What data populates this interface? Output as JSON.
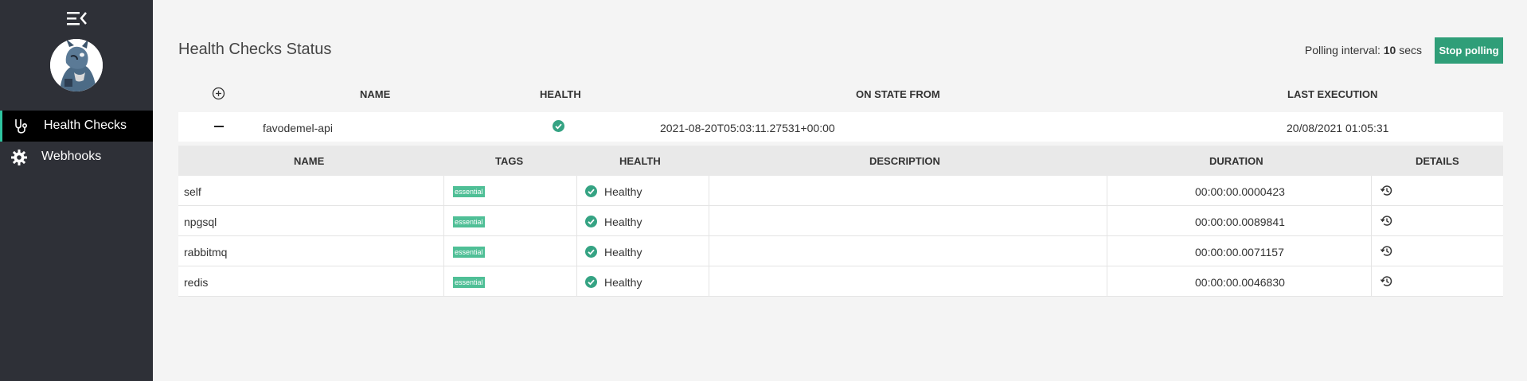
{
  "sidebar": {
    "items": [
      {
        "label": "Health Checks",
        "icon": "stethoscope-icon",
        "active": true
      },
      {
        "label": "Webhooks",
        "icon": "gear-icon",
        "active": false
      }
    ]
  },
  "header": {
    "title": "Health Checks Status",
    "polling_prefix": "Polling interval: ",
    "polling_value": "10",
    "polling_suffix": " secs",
    "stop_label": "Stop polling"
  },
  "outer_table": {
    "columns": [
      "NAME",
      "HEALTH",
      "ON STATE FROM",
      "LAST EXECUTION"
    ],
    "service": {
      "name": "favodemel-api",
      "on_state_from": "2021-08-20T05:03:11.27531+00:00",
      "last_execution": "20/08/2021 01:05:31"
    }
  },
  "inner_table": {
    "columns": [
      "NAME",
      "TAGS",
      "HEALTH",
      "DESCRIPTION",
      "DURATION",
      "DETAILS"
    ],
    "rows": [
      {
        "name": "self",
        "tag": "essential",
        "health": "Healthy",
        "description": "",
        "duration": "00:00:00.0000423"
      },
      {
        "name": "npgsql",
        "tag": "essential",
        "health": "Healthy",
        "description": "",
        "duration": "00:00:00.0089841"
      },
      {
        "name": "rabbitmq",
        "tag": "essential",
        "health": "Healthy",
        "description": "",
        "duration": "00:00:00.0071157"
      },
      {
        "name": "redis",
        "tag": "essential",
        "health": "Healthy",
        "description": "",
        "duration": "00:00:00.0046830"
      }
    ]
  },
  "colors": {
    "accent": "#2f9e78",
    "tag": "#4fbf96",
    "sidebar": "#2e3037",
    "healthy": "#35a383"
  }
}
